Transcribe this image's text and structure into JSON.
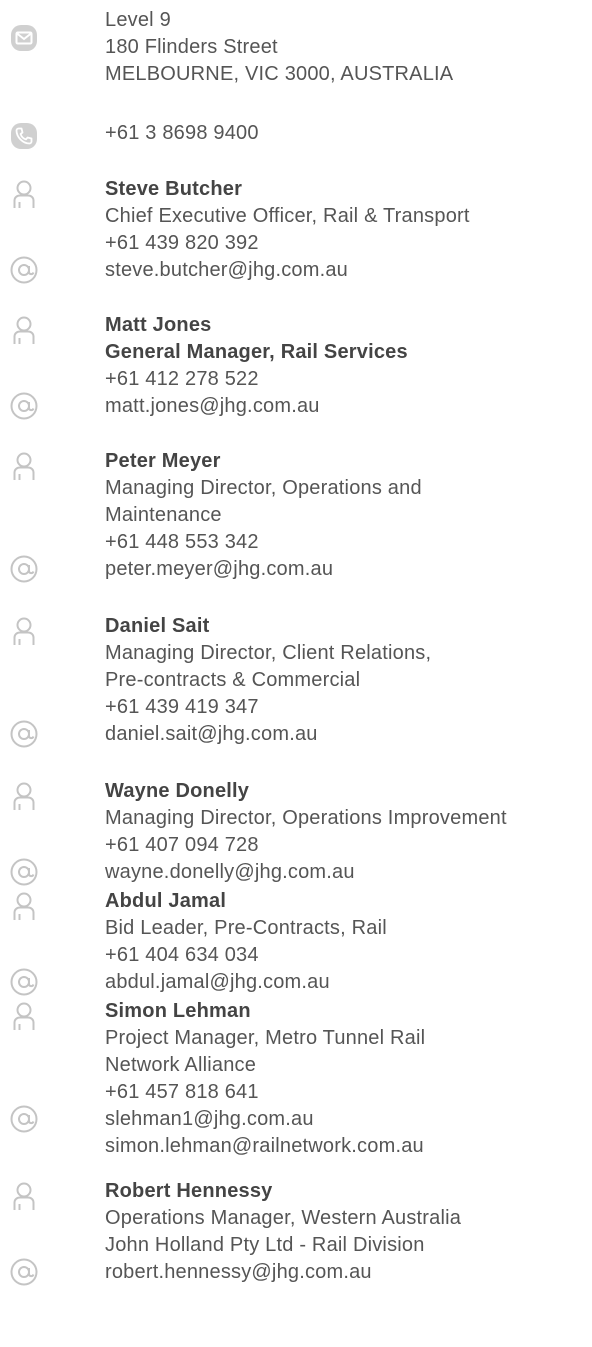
{
  "address": {
    "icon": "envelope-icon",
    "lines": [
      "Level 9",
      "180 Flinders Street",
      "MELBOURNE, VIC 3000, AUSTRALIA"
    ]
  },
  "phone": {
    "icon": "phone-icon",
    "number": "+61 3 8698 9400"
  },
  "contacts": [
    {
      "name": "Steve Butcher",
      "title_lines": [
        "Chief Executive Officer, Rail & Transport"
      ],
      "title_bold": false,
      "phone": "+61 439 820 392",
      "emails": [
        "steve.butcher@jhg.com.au"
      ]
    },
    {
      "name": "Matt Jones",
      "title_lines": [
        "General Manager, Rail Services"
      ],
      "title_bold": true,
      "phone": "+61 412 278 522",
      "emails": [
        "matt.jones@jhg.com.au"
      ]
    },
    {
      "name": "Peter Meyer",
      "title_lines": [
        "Managing Director, Operations and",
        "Maintenance"
      ],
      "title_bold": false,
      "phone": "+61 448 553 342",
      "emails": [
        "peter.meyer@jhg.com.au"
      ]
    },
    {
      "name": "Daniel Sait",
      "title_lines": [
        "Managing Director, Client Relations,",
        "Pre-contracts & Commercial"
      ],
      "title_bold": false,
      "phone": "+61 439 419 347",
      "emails": [
        "daniel.sait@jhg.com.au"
      ]
    },
    {
      "name": "Wayne Donelly",
      "title_lines": [
        "Managing Director, Operations Improvement"
      ],
      "title_bold": false,
      "phone": "+61 407 094 728",
      "emails": [
        "wayne.donelly@jhg.com.au"
      ]
    },
    {
      "name": "Abdul Jamal",
      "title_lines": [
        "Bid Leader, Pre-Contracts, Rail"
      ],
      "title_bold": false,
      "phone": "+61 404 634 034",
      "emails": [
        "abdul.jamal@jhg.com.au"
      ]
    },
    {
      "name": "Simon Lehman",
      "title_lines": [
        "Project Manager, Metro Tunnel Rail",
        "Network Alliance"
      ],
      "title_bold": false,
      "phone": "+61 457 818 641",
      "emails": [
        "slehman1@jhg.com.au",
        "simon.lehman@railnetwork.com.au"
      ]
    },
    {
      "name": "Robert Hennessy",
      "title_lines": [
        "Operations Manager, Western Australia",
        "John Holland Pty Ltd - Rail Division"
      ],
      "title_bold": false,
      "phone": "",
      "emails": [
        "robert.hennessy@jhg.com.au"
      ]
    }
  ],
  "colors": {
    "text": "#555555",
    "name": "#444444",
    "icon": "#bdbdbd"
  },
  "icons": {
    "person": "person-icon",
    "email": "at-sign-icon"
  }
}
